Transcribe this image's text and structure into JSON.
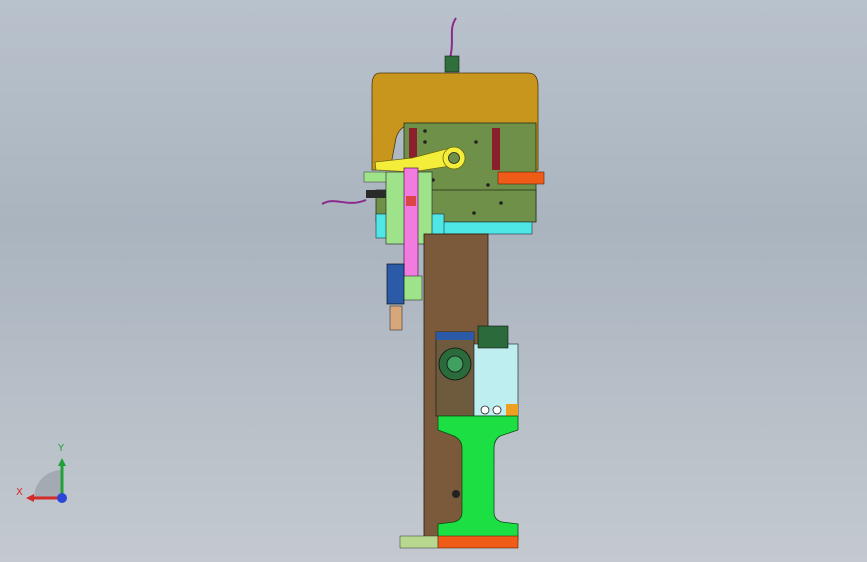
{
  "viewport": {
    "background_top": "#b9c2cc",
    "background_bottom": "#c3c9cf"
  },
  "model": {
    "name_visible": false,
    "colors": {
      "cover": "#c8961c",
      "frame_panel": "#6f9048",
      "slot": "#8a1f2e",
      "pink_bar": "#f27be0",
      "yellow_arm": "#f4ee3b",
      "cyan_strip": "#4fe6e6",
      "column": "#7a5a3a",
      "green_base": "#1ce043",
      "orange_tab": "#f05b18",
      "cylinder": "#bfeef0",
      "dark_block": "#6e5a3c",
      "blue_sensor": "#2a5aa8",
      "cable": "#8a2a8a"
    }
  },
  "triad": {
    "x_label": "X",
    "y_label": "Y",
    "x_color": "#d42a2a",
    "y_color": "#1fa23a",
    "z_color": "#2b46d8"
  }
}
